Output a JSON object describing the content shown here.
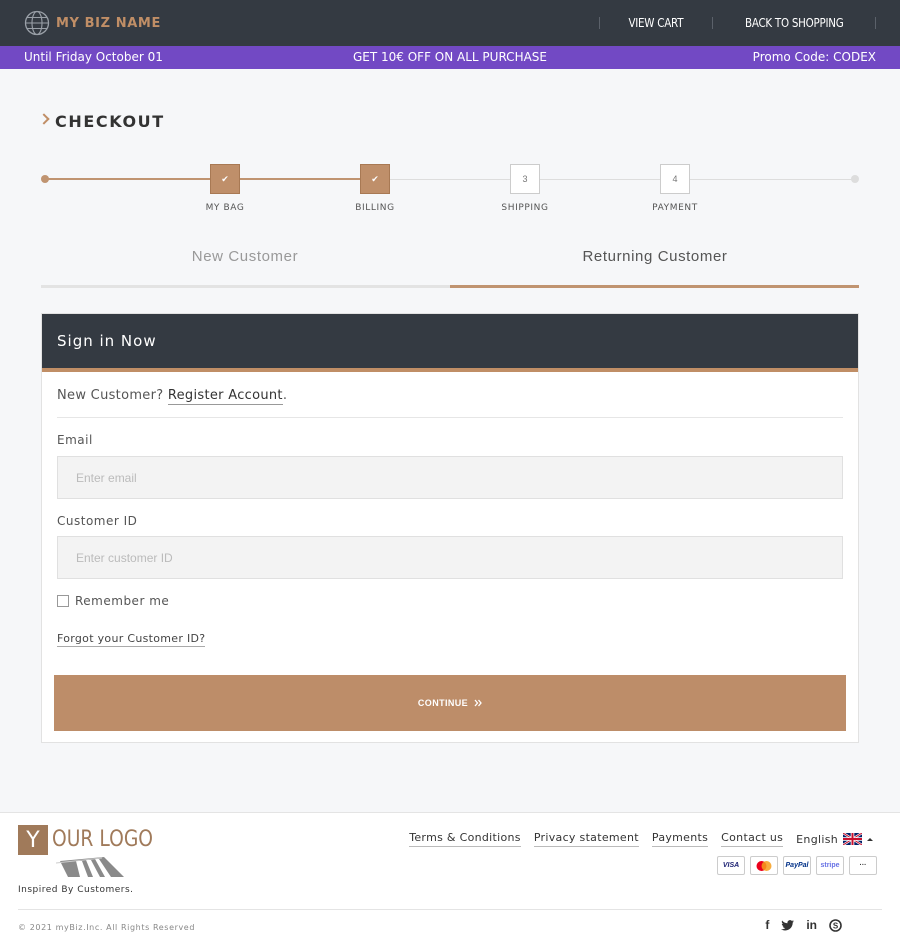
{
  "header": {
    "brand_name": "MY BIZ NAME",
    "nav": {
      "view_cart": "VIEW CART",
      "back_to_shopping": "BACK TO SHOPPING"
    }
  },
  "promo": {
    "left": "Until Friday October 01",
    "center": "GET 10€ OFF ON ALL PURCHASE",
    "right": "Promo Code: CODEX"
  },
  "checkout": {
    "title": "CHECKOUT",
    "steps": [
      {
        "label": "MY BAG",
        "state": "done",
        "marker": "✔"
      },
      {
        "label": "BILLING",
        "state": "done",
        "marker": "✔"
      },
      {
        "label": "SHIPPING",
        "state": "todo",
        "marker": "3"
      },
      {
        "label": "PAYMENT",
        "state": "todo",
        "marker": "4"
      }
    ],
    "progress_color": "#bf8f6a"
  },
  "tabs": {
    "new_customer": "New Customer",
    "returning_customer": "Returning Customer",
    "active": "returning_customer"
  },
  "signin": {
    "title": "Sign in Now",
    "new_customer_prefix": "New Customer?",
    "register_link": "Register Account",
    "register_suffix": ".",
    "email_label": "Email",
    "email_placeholder": "Enter email",
    "email_value": "",
    "customer_id_label": "Customer ID",
    "customer_id_placeholder": "Enter customer ID",
    "customer_id_value": "",
    "remember_label": "Remember me",
    "remember_checked": false,
    "forgot_link": "Forgot your Customer ID?",
    "continue_label": "CONTINUE",
    "continue_icon": "double-chevron-right-icon"
  },
  "footer": {
    "logo_letter": "Y",
    "logo_text": "OUR LOGO",
    "tagline": "Inspired By Customers.",
    "links": [
      "Terms & Conditions",
      "Privacy statement",
      "Payments",
      "Contact us"
    ],
    "language": "English",
    "payments": [
      {
        "name": "VISA",
        "color": "#1a1f71"
      },
      {
        "name": "mastercard",
        "color": "#eb001b"
      },
      {
        "name": "PayPal",
        "color": "#003087"
      },
      {
        "name": "stripe",
        "color": "#6772e5"
      },
      {
        "name": "···",
        "color": "#333333"
      }
    ],
    "copyright": "© 2021 myBiz.Inc. All Rights Reserved",
    "social": [
      "facebook-icon",
      "twitter-icon",
      "linkedin-icon",
      "skype-icon"
    ]
  },
  "colors": {
    "dark": "#343a42",
    "accent": "#c08e66",
    "promo": "#7249c4"
  }
}
